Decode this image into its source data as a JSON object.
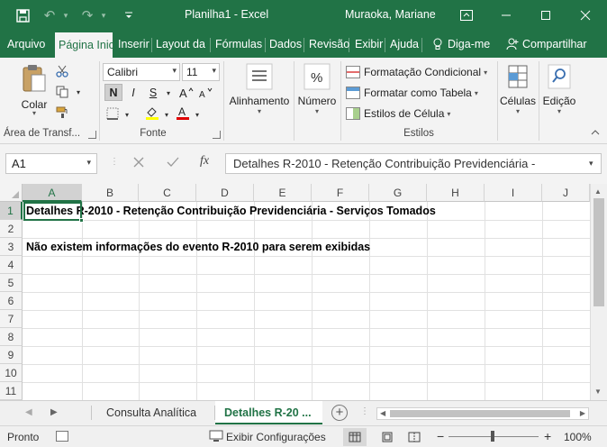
{
  "window": {
    "title": "Planilha1  -  Excel",
    "user": "Muraoka, Mariane",
    "accent": "#217346"
  },
  "ribbon_tabs": [
    "Arquivo",
    "Página Inic",
    "Inserir",
    "Layout da",
    "Fórmulas",
    "Dados",
    "Revisão",
    "Exibir",
    "Ajuda",
    "Diga-me",
    "Compartilhar"
  ],
  "ribbon": {
    "clipboard": {
      "paste_label": "Colar",
      "group_label": "Área de Transf..."
    },
    "font": {
      "family": "Calibri",
      "size": "11",
      "bold": "N",
      "italic": "I",
      "underline": "S",
      "group_label": "Fonte"
    },
    "alignment_label": "Alinhamento",
    "number_label": "Número",
    "styles": {
      "conditional": "Formatação Condicional",
      "as_table": "Formatar como Tabela",
      "cell_styles": "Estilos de Célula",
      "group_label": "Estilos"
    },
    "cells_label": "Células",
    "editing_label": "Edição"
  },
  "formula_bar": {
    "name_box": "A1",
    "fx": "fx",
    "content": "Detalhes R-2010 - Retenção Contribuição Previdenciária -"
  },
  "grid": {
    "columns": [
      "A",
      "B",
      "C",
      "D",
      "E",
      "F",
      "G",
      "H",
      "I",
      "J"
    ],
    "rows": [
      "1",
      "2",
      "3",
      "4",
      "5",
      "6",
      "7",
      "8",
      "9",
      "10",
      "11"
    ],
    "selected_cell": "A1",
    "cells": {
      "A1": "Detalhes R-2010 - Retenção Contribuição Previdenciária - Serviços Tomados",
      "A3": "Não existem informações do evento R-2010 para serem exibidas"
    }
  },
  "sheets": {
    "tabs": [
      "Consulta Analítica",
      "Detalhes R-20 ..."
    ],
    "active": "Detalhes R-20 ..."
  },
  "status": {
    "ready": "Pronto",
    "display_settings": "Exibir Configurações",
    "zoom": "100%"
  }
}
